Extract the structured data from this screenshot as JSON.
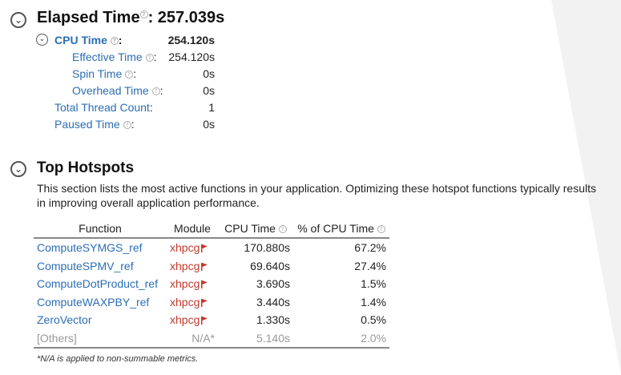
{
  "summary": {
    "title": "Elapsed Time",
    "title_value": ": 257.039s",
    "metrics": [
      {
        "label": "CPU Time",
        "suffix": ":",
        "value": "254.120s"
      },
      {
        "label": "Effective Time",
        "suffix": ":",
        "value": "254.120s"
      },
      {
        "label": "Spin Time",
        "suffix": ":",
        "value": "0s"
      },
      {
        "label": "Overhead Time",
        "suffix": ":",
        "value": "0s"
      },
      {
        "label": "Total Thread Count",
        "suffix": ":",
        "value": "1"
      },
      {
        "label": "Paused Time",
        "suffix": ":",
        "value": "0s"
      }
    ]
  },
  "hotspots": {
    "title": "Top Hotspots",
    "description": "This section lists the most active functions in your application. Optimizing these hotspot functions typically results in improving overall application performance.",
    "columns": {
      "function": "Function",
      "module": "Module",
      "cpu_time": "CPU Time",
      "pct_cpu": "% of CPU Time"
    },
    "rows": [
      {
        "function": "ComputeSYMGS_ref",
        "module": "xhpcg",
        "cpu_time": "170.880s",
        "pct": "67.2%"
      },
      {
        "function": "ComputeSPMV_ref",
        "module": "xhpcg",
        "cpu_time": "69.640s",
        "pct": "27.4%"
      },
      {
        "function": "ComputeDotProduct_ref",
        "module": "xhpcg",
        "cpu_time": "3.690s",
        "pct": "1.5%"
      },
      {
        "function": "ComputeWAXPBY_ref",
        "module": "xhpcg",
        "cpu_time": "3.440s",
        "pct": "1.4%"
      },
      {
        "function": "ZeroVector",
        "module": "xhpcg",
        "cpu_time": "1.330s",
        "pct": "0.5%"
      }
    ],
    "others": {
      "function": "[Others]",
      "module": "N/A*",
      "cpu_time": "5.140s",
      "pct": "2.0%"
    },
    "footnote": "*N/A is applied to non-summable metrics."
  },
  "icons": {
    "collapse": "collapse-circle-icon",
    "help": "help-icon",
    "flag": "flag-icon"
  },
  "colors": {
    "link": "#2b6eb5",
    "module": "#c0392b",
    "muted": "#999999",
    "background_shape": "#f2f2f2"
  }
}
